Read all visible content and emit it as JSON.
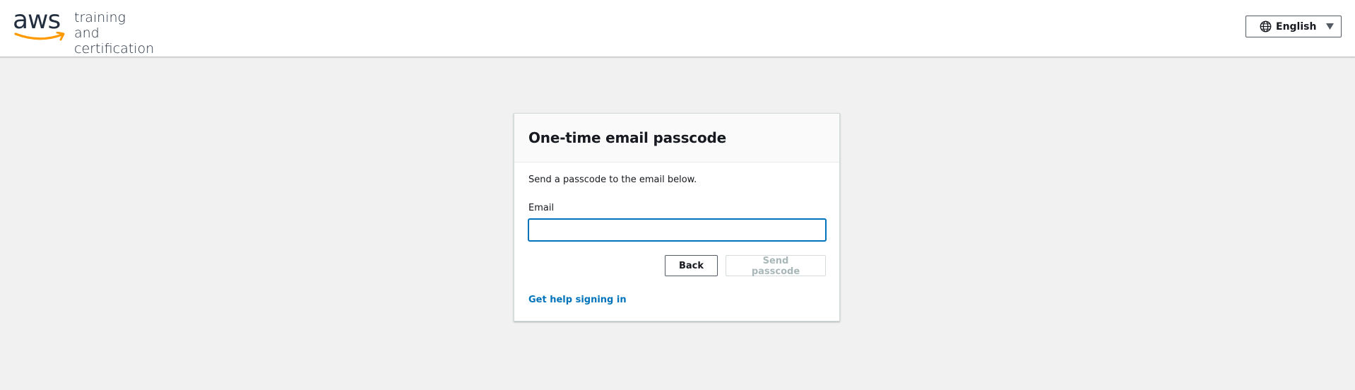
{
  "header": {
    "logo_text": "aws",
    "tagline_line1": "training and",
    "tagline_line2": "certification",
    "language_label": "English"
  },
  "card": {
    "title": "One-time email passcode",
    "description": "Send a passcode to the email below.",
    "email_label": "Email",
    "email_value": "",
    "back_label": "Back",
    "send_label": "Send passcode",
    "help_link": "Get help signing in"
  },
  "colors": {
    "background": "#f0f1f0",
    "link": "#0073bb",
    "focus_border": "#0073bb",
    "aws_smile": "#ff9900",
    "disabled_text": "#aab7b8"
  },
  "icons": {
    "language": "globe-icon",
    "dropdown": "caret-down-icon"
  }
}
